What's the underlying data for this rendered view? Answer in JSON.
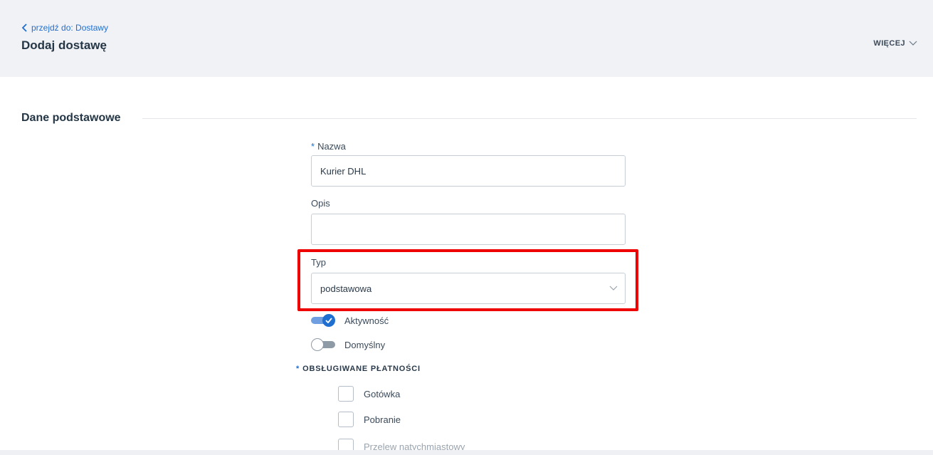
{
  "header": {
    "back_label": "przejdź do: Dostawy",
    "title": "Dodaj dostawę",
    "more_label": "WIĘCEJ"
  },
  "section": {
    "title": "Dane podstawowe"
  },
  "form": {
    "name": {
      "label": "Nazwa",
      "required_mark": "*",
      "value": "Kurier DHL"
    },
    "description": {
      "label": "Opis",
      "value": ""
    },
    "type": {
      "label": "Typ",
      "value": "podstawowa"
    },
    "active": {
      "label": "Aktywność",
      "checked": true
    },
    "default": {
      "label": "Domyślny",
      "checked": false
    }
  },
  "payments": {
    "required_mark": "*",
    "title": "OBSŁUGIWANE PŁATNOŚCI",
    "options": [
      {
        "label": "Gotówka",
        "checked": false
      },
      {
        "label": "Pobranie",
        "checked": false
      },
      {
        "label": "Przelew natychmiastowy",
        "checked": false
      }
    ]
  },
  "colors": {
    "accent": "#1f6fd0",
    "highlight": "#ee0000",
    "header_bg": "#f1f2f6"
  }
}
